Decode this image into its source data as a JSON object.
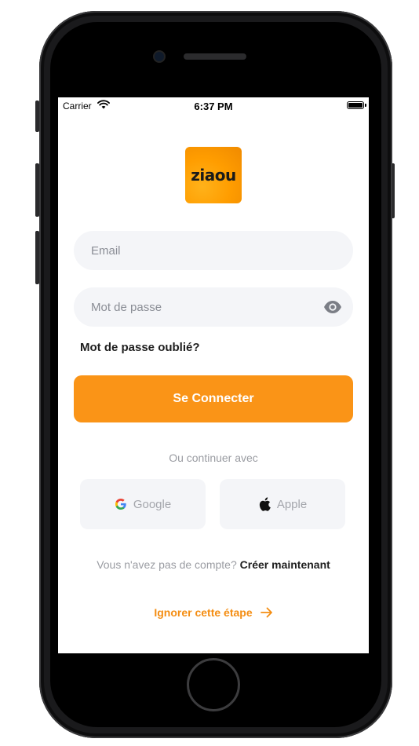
{
  "status_bar": {
    "carrier": "Carrier",
    "time": "6:37 PM"
  },
  "logo": {
    "text": "ziaou",
    "brand_color": "#fa9417"
  },
  "form": {
    "email_placeholder": "Email",
    "password_placeholder": "Mot de passe",
    "forgot_password": "Mot de passe oublié?",
    "submit_label": "Se Connecter"
  },
  "social": {
    "divider": "Ou continuer avec",
    "google_label": "Google",
    "apple_label": "Apple"
  },
  "signup": {
    "prompt": "Vous n'avez pas de compte?",
    "link": "Créer maintenant"
  },
  "skip": {
    "label": "Ignorer cette étape"
  },
  "colors": {
    "accent": "#fa9417",
    "field_bg": "#f4f5f8",
    "muted_text": "#9a9ca2"
  }
}
